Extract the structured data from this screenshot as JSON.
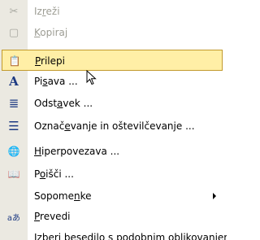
{
  "menu": {
    "items": [
      {
        "id": "izrezi",
        "pre": "Iz",
        "u": "r",
        "post": "eži",
        "icon": "scissors-icon",
        "glyph": "✂",
        "state": "disabled"
      },
      {
        "id": "kopiraj",
        "pre": "",
        "u": "K",
        "post": "opiraj",
        "icon": "copy-icon",
        "glyph": "▢",
        "state": "disabled"
      },
      {
        "id": "prilepi",
        "pre": "",
        "u": "P",
        "post": "rilepi",
        "icon": "paste-icon",
        "glyph": "📋",
        "state": "selected"
      },
      {
        "id": "pisava",
        "pre": "Pi",
        "u": "s",
        "post": "ava ...",
        "icon": "font-icon",
        "glyph": "A",
        "state": "normal"
      },
      {
        "id": "odstavek",
        "pre": "Odst",
        "u": "a",
        "post": "vek ...",
        "icon": "paragraph-icon",
        "glyph": "≣",
        "state": "normal"
      },
      {
        "id": "oznacevanje",
        "pre": "Označ",
        "u": "e",
        "post": "vanje in oštevilčevanje ...",
        "icon": "bullets-numbering-icon",
        "glyph": "☰",
        "state": "normal"
      },
      {
        "id": "hiperpovezava",
        "pre": "",
        "u": "H",
        "post": "iperpovezava ...",
        "icon": "hyperlink-icon",
        "glyph": "🌐",
        "state": "normal"
      },
      {
        "id": "poisci",
        "pre": "P",
        "u": "o",
        "post": "išči ...",
        "icon": "research-icon",
        "glyph": "📖",
        "state": "normal"
      },
      {
        "id": "sopomenke",
        "pre": "Sopome",
        "u": "n",
        "post": "ke",
        "icon": "",
        "glyph": "",
        "state": "normal",
        "submenu": true
      },
      {
        "id": "prevedi",
        "pre": "",
        "u": "P",
        "post": "revedi",
        "icon": "translate-icon",
        "glyph": "aあ",
        "state": "normal"
      },
      {
        "id": "izberi",
        "pre": "Izberi besedilo s podobnim oblikovanjem",
        "u": "",
        "post": "",
        "icon": "",
        "glyph": "",
        "state": "normal"
      }
    ]
  }
}
